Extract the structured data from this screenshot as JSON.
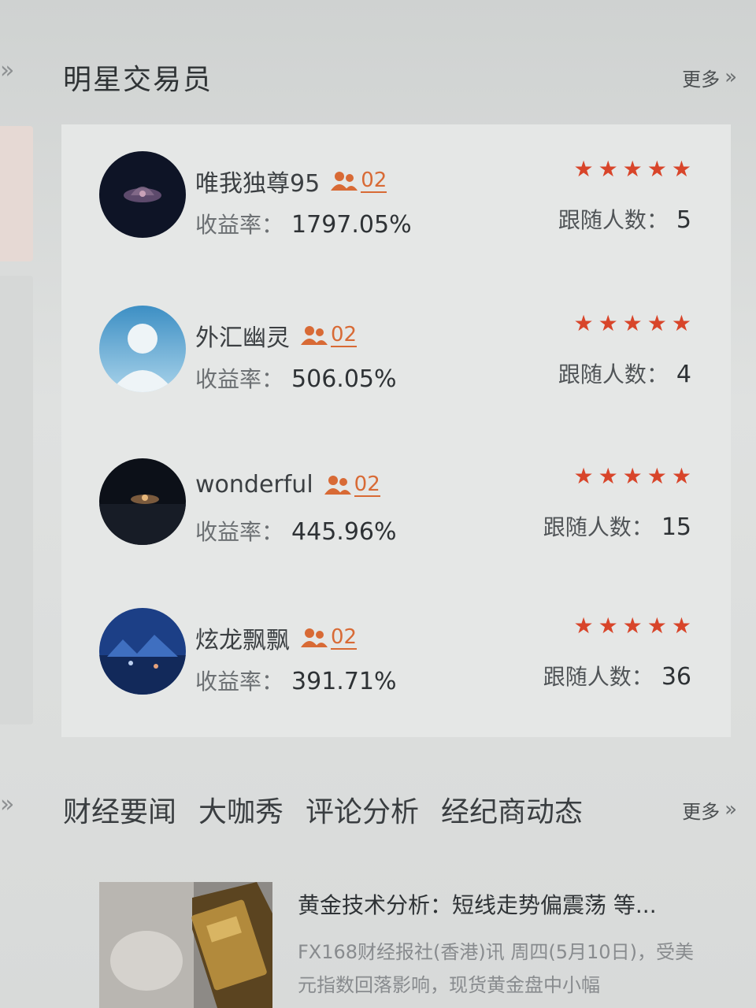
{
  "section": {
    "title": "明星交易员",
    "more_label": "更多"
  },
  "traders": [
    {
      "name": "唯我独尊95",
      "group_count": "02",
      "yield_label": "收益率：",
      "yield_value": "1797.05%",
      "rating": 5,
      "followers_label": "跟随人数：",
      "followers_value": "5",
      "avatar": "dark-lotus"
    },
    {
      "name": "外汇幽灵",
      "group_count": "02",
      "yield_label": "收益率：",
      "yield_value": "506.05%",
      "rating": 5,
      "followers_label": "跟随人数：",
      "followers_value": "4",
      "avatar": "default-user"
    },
    {
      "name": "wonderful",
      "group_count": "02",
      "yield_label": "收益率：",
      "yield_value": "445.96%",
      "rating": 5,
      "followers_label": "跟随人数：",
      "followers_value": "15",
      "avatar": "night-scene"
    },
    {
      "name": "炫龙飘飘",
      "group_count": "02",
      "yield_label": "收益率：",
      "yield_value": "391.71%",
      "rating": 5,
      "followers_label": "跟随人数：",
      "followers_value": "36",
      "avatar": "blue-city"
    }
  ],
  "news_tabs": {
    "items": [
      "财经要闻",
      "大咖秀",
      "评论分析",
      "经纪商动态"
    ],
    "more_label": "更多"
  },
  "news": [
    {
      "title": "黄金技术分析：短线走势偏震荡 等...",
      "body": "FX168财经报社(香港)讯 周四(5月10日)，受美元指数回落影响，现货黄金盘中小幅",
      "thumb": "gold-bars"
    }
  ],
  "colors": {
    "accent_orange": "#d86a35",
    "star_red": "#d8452a"
  },
  "icons": {
    "group": "group-icon",
    "star": "star-icon",
    "more": "double-chevron-right-icon"
  }
}
